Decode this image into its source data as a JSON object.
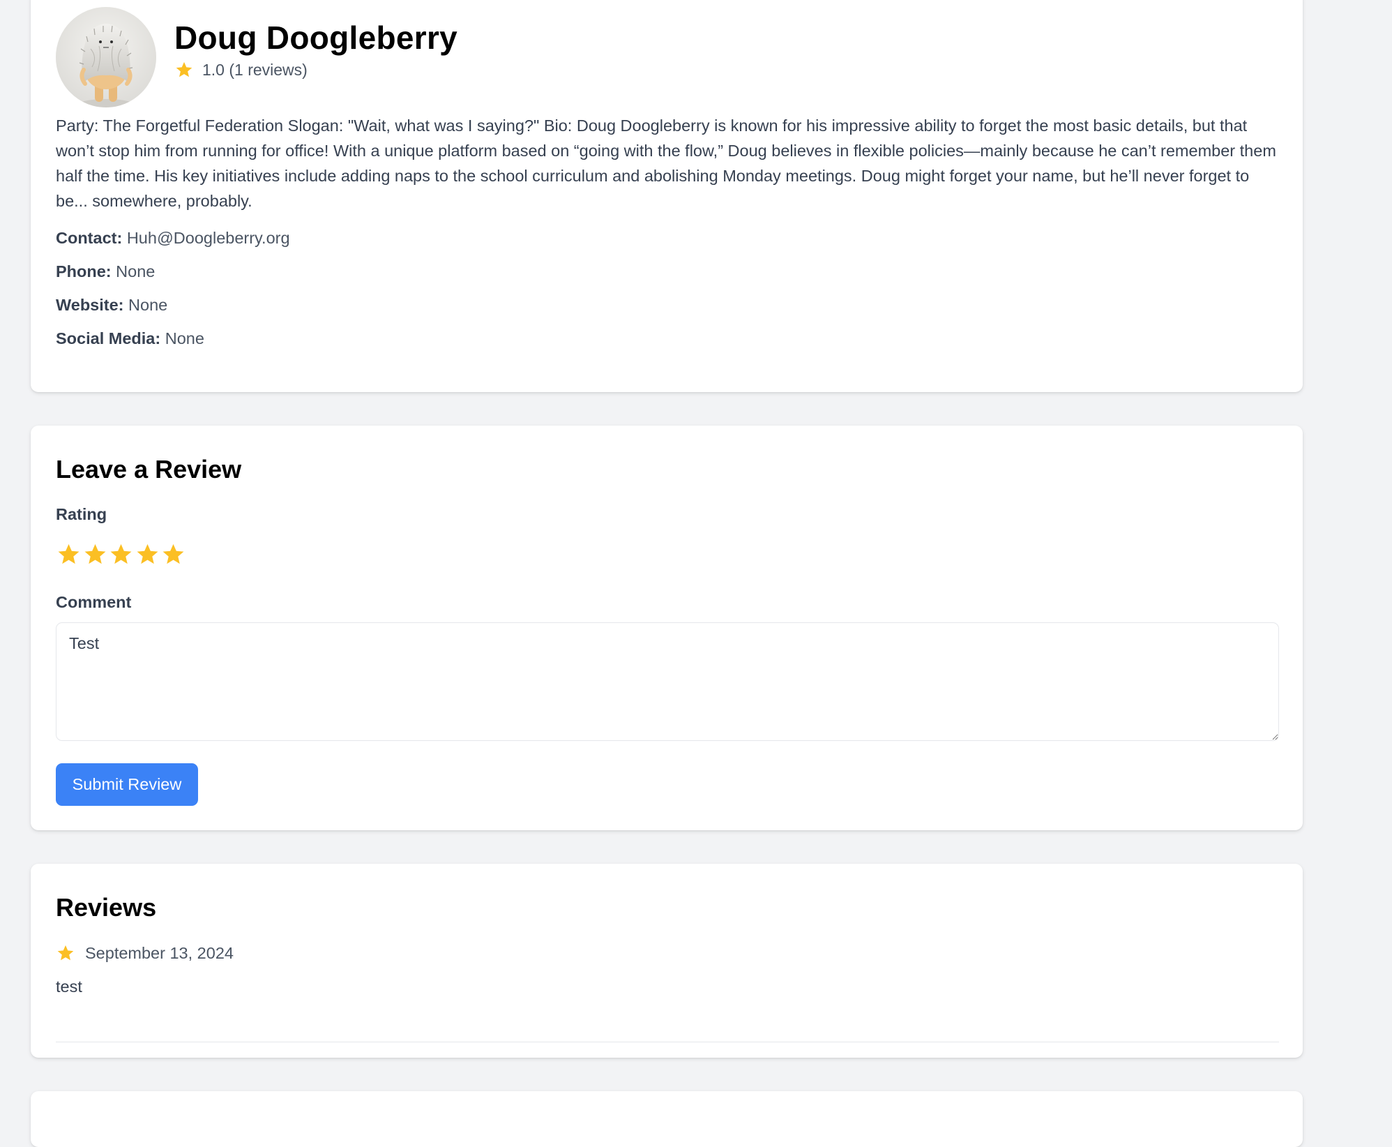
{
  "candidate": {
    "name": "Doug Doogleberry",
    "rating_text": "1.0 (1 reviews)",
    "bio": "Party: The Forgetful Federation Slogan: \"Wait, what was I saying?\" Bio: Doug Doogleberry is known for his impressive ability to forget the most basic details, but that won’t stop him from running for office! With a unique platform based on “going with the flow,” Doug believes in flexible policies—mainly because he can’t remember them half the time. His key initiatives include adding naps to the school curriculum and abolishing Monday meetings. Doug might forget your name, but he’ll never forget to be... somewhere, probably.",
    "details": [
      {
        "label": "Contact:",
        "value": "Huh@Doogleberry.org"
      },
      {
        "label": "Phone:",
        "value": "None"
      },
      {
        "label": "Website:",
        "value": "None"
      },
      {
        "label": "Social Media:",
        "value": "None"
      }
    ]
  },
  "review_form": {
    "title": "Leave a Review",
    "rating_label": "Rating",
    "stars_selected": 5,
    "comment_label": "Comment",
    "comment_value": "Test",
    "submit_label": "Submit Review"
  },
  "reviews": {
    "title": "Reviews",
    "items": [
      {
        "stars": 1,
        "date": "September 13, 2024",
        "text": "test"
      }
    ]
  },
  "colors": {
    "star": "#fbbf24",
    "primary": "#3b82f6",
    "background": "#f2f3f5"
  }
}
